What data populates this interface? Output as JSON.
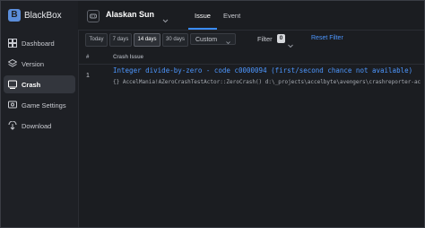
{
  "app": {
    "name": "BlackBox",
    "logo_glyph": "B"
  },
  "sidebar": {
    "items": [
      {
        "label": "Dashboard",
        "icon": "dashboard-icon",
        "active": false
      },
      {
        "label": "Version",
        "icon": "version-icon",
        "active": false
      },
      {
        "label": "Crash",
        "icon": "crash-icon",
        "active": true
      },
      {
        "label": "Game Settings",
        "icon": "settings-icon",
        "active": false
      },
      {
        "label": "Download",
        "icon": "download-icon",
        "active": false
      }
    ]
  },
  "header": {
    "game_name": "Alaskan Sun",
    "tabs": [
      {
        "label": "Issue",
        "active": true
      },
      {
        "label": "Event",
        "active": false
      }
    ]
  },
  "toolbar": {
    "ranges": [
      {
        "label": "Today",
        "active": false
      },
      {
        "label": "7 days",
        "active": false
      },
      {
        "label": "14 days",
        "active": true
      },
      {
        "label": "30 days",
        "active": false
      }
    ],
    "custom_select": "Custom",
    "filter_label": "Filter",
    "filter_count": "0",
    "reset_label": "Reset Filter"
  },
  "table": {
    "headers": {
      "num": "#",
      "issue": "Crash Issue"
    },
    "rows": [
      {
        "num": "1",
        "title": "Integer divide-by-zero - code c0000094 (first/second chance not available)",
        "sub": "{}  AccelMania!AZeroCrashTestActor::ZeroCrash() d:\\_projects\\accelbyte\\avengers\\crashreporter-ac"
      }
    ]
  },
  "colors": {
    "accent": "#3a8cff",
    "link": "#4d97ff",
    "background": "#1b1d21",
    "sidebar": "#1e2025"
  }
}
